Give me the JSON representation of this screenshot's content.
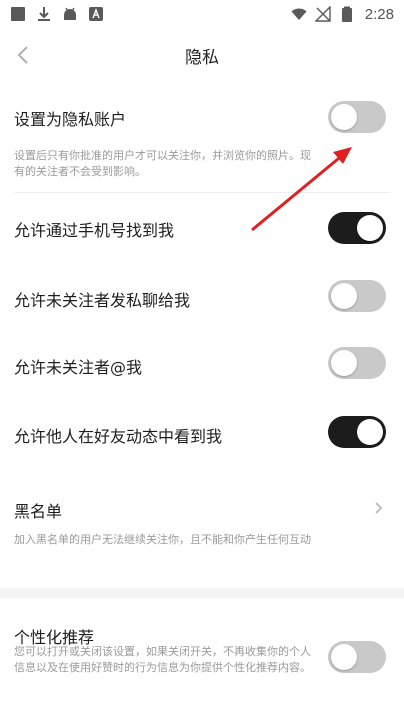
{
  "status_bar": {
    "time": "2:28"
  },
  "nav": {
    "title": "隐私"
  },
  "settings": {
    "private_account": {
      "title": "设置为隐私账户",
      "desc": "设置后只有你批准的用户才可以关注你，并浏览你的照片。现有的关注者不会受到影响。",
      "enabled": false
    },
    "find_by_phone": {
      "title": "允许通过手机号找到我",
      "enabled": true
    },
    "dm_from_nonfollowers": {
      "title": "允许未关注者发私聊给我",
      "enabled": false
    },
    "mention_by_nonfollowers": {
      "title": "允许未关注者@我",
      "enabled": false
    },
    "see_me_in_friend_feed": {
      "title": "允许他人在好友动态中看到我",
      "enabled": true
    },
    "blacklist": {
      "title": "黑名单",
      "desc": "加入黑名单的用户无法继续关注你，且不能和你产生任何互动"
    },
    "personalized_recommend": {
      "title": "个性化推荐",
      "desc": "您可以打开或关闭该设置，如果关闭开关，不再收集你的个人信息以及在使用好赞时的行为信息为你提供个性化推荐内容。",
      "enabled": false
    }
  },
  "colors": {
    "toggle_on": "#1c1c1c",
    "toggle_off": "#c9c9c9",
    "annotation_arrow": "#e02020"
  },
  "icons": {
    "back": "chevron-left-icon",
    "row_chevron": "chevron-right-icon"
  }
}
